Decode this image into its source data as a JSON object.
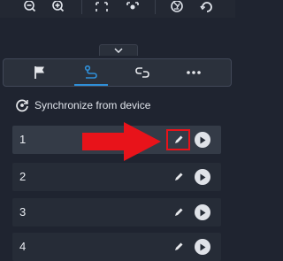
{
  "toolbar": {
    "icons": [
      "zoom-out-icon",
      "zoom-in-icon",
      "fit-screen-icon",
      "focus-icon",
      "aperture-icon",
      "refresh-icon"
    ]
  },
  "collapse": {
    "icon": "chevron-down-icon"
  },
  "tabs": [
    {
      "icon": "flag-icon",
      "active": false
    },
    {
      "icon": "route-icon",
      "active": true
    },
    {
      "icon": "link-icon",
      "active": false
    },
    {
      "icon": "more-icon",
      "active": false
    }
  ],
  "sync": {
    "label": "Synchronize from device",
    "icon": "sync-icon"
  },
  "rows": [
    {
      "label": "1",
      "selected": true
    },
    {
      "label": "2",
      "selected": false
    },
    {
      "label": "3",
      "selected": false
    },
    {
      "label": "4",
      "selected": false
    }
  ],
  "colors": {
    "background": "#1f2430",
    "accent": "#2f8fd8",
    "annotation": "#e8131a"
  }
}
